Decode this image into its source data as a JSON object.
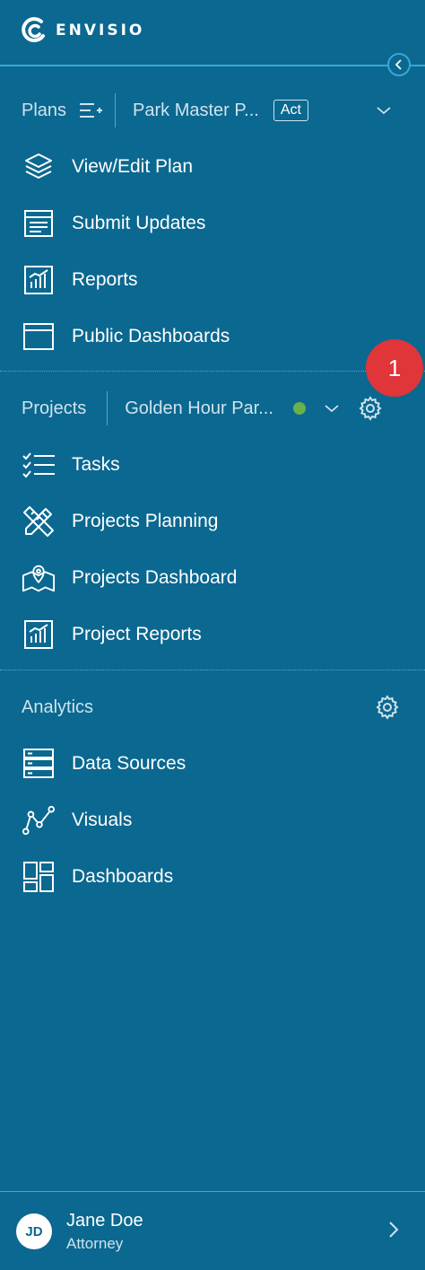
{
  "brand": {
    "name": "ENVISIO"
  },
  "plans": {
    "label": "Plans",
    "selected_plan": "Park Master P...",
    "status_badge": "Act",
    "items": [
      {
        "label": "View/Edit Plan",
        "icon": "layers-icon"
      },
      {
        "label": "Submit Updates",
        "icon": "form-icon"
      },
      {
        "label": "Reports",
        "icon": "bar-chart-icon"
      },
      {
        "label": "Public Dashboards",
        "icon": "browser-window-icon"
      }
    ]
  },
  "notification": {
    "count": "1",
    "color": "#e03539"
  },
  "projects": {
    "label": "Projects",
    "selected_project": "Golden Hour Par...",
    "status_color": "#6ab04c",
    "items": [
      {
        "label": "Tasks",
        "icon": "checklist-icon"
      },
      {
        "label": "Projects Planning",
        "icon": "pencil-ruler-icon"
      },
      {
        "label": "Projects Dashboard",
        "icon": "map-pin-icon"
      },
      {
        "label": "Project Reports",
        "icon": "bar-chart-icon"
      }
    ]
  },
  "analytics": {
    "label": "Analytics",
    "items": [
      {
        "label": "Data Sources",
        "icon": "database-icon"
      },
      {
        "label": "Visuals",
        "icon": "line-graph-icon"
      },
      {
        "label": "Dashboards",
        "icon": "grid-icon"
      }
    ]
  },
  "user": {
    "initials": "JD",
    "name": "Jane Doe",
    "role": "Attorney"
  },
  "colors": {
    "background": "#0b6890",
    "accent": "#3aa7d3",
    "text": "#ffffff",
    "muted_text": "#cfe3ee"
  }
}
